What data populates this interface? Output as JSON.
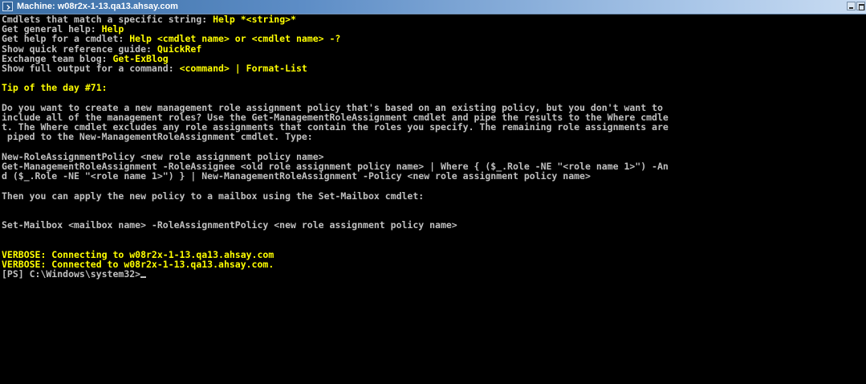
{
  "window": {
    "title": "Machine: w08r2x-1-13.qa13.ahsay.com"
  },
  "console": {
    "help": [
      {
        "text": "Cmdlets that match a specific string: ",
        "cmd": "Help *<string>*"
      },
      {
        "text": "Get general help: ",
        "cmd": "Help"
      },
      {
        "text": "Get help for a cmdlet: ",
        "cmd": "Help <cmdlet name> or <cmdlet name> -?"
      },
      {
        "text": "Show quick reference guide: ",
        "cmd": "QuickRef"
      },
      {
        "text": "Exchange team blog: ",
        "cmd": "Get-ExBlog"
      },
      {
        "text": "Show full output for a command: ",
        "cmd": "<command> | Format-List"
      }
    ],
    "tip_heading": "Tip of the day #71:",
    "tip_body": [
      "Do you want to create a new management role assignment policy that's based on an existing policy, but you don't want to",
      "include all of the management roles? Use the Get-ManagementRoleAssignment cmdlet and pipe the results to the Where cmdle",
      "t. The Where cmdlet excludes any role assignments that contain the roles you specify. The remaining role assignments are",
      " piped to the New-ManagementRoleAssignment cmdlet. Type:"
    ],
    "example_lines": [
      "New-RoleAssignmentPolicy <new role assignment policy name>",
      "Get-ManagementRoleAssignment -RoleAssignee <old role assignment policy name> | Where { ($_.Role -NE \"<role name 1>\") -An",
      "d ($_.Role -NE \"<role name 1>\") } | New-ManagementRoleAssignment -Policy <new role assignment policy name>"
    ],
    "then_line": "Then you can apply the new policy to a mailbox using the Set-Mailbox cmdlet:",
    "set_mailbox_line": "Set-Mailbox <mailbox name> -RoleAssignmentPolicy <new role assignment policy name>",
    "verbose": [
      "VERBOSE: Connecting to w08r2x-1-13.qa13.ahsay.com",
      "VERBOSE: Connected to w08r2x-1-13.qa13.ahsay.com."
    ],
    "prompt": "[PS] C:\\Windows\\system32>"
  },
  "icons": {
    "app": "powershell-console-icon",
    "minimize": "minimize-icon",
    "maximize": "maximize-icon"
  },
  "colors": {
    "background": "#000000",
    "text": "#c0c0c0",
    "highlight": "#ffff00",
    "titlebar": "#3a6ea5"
  }
}
